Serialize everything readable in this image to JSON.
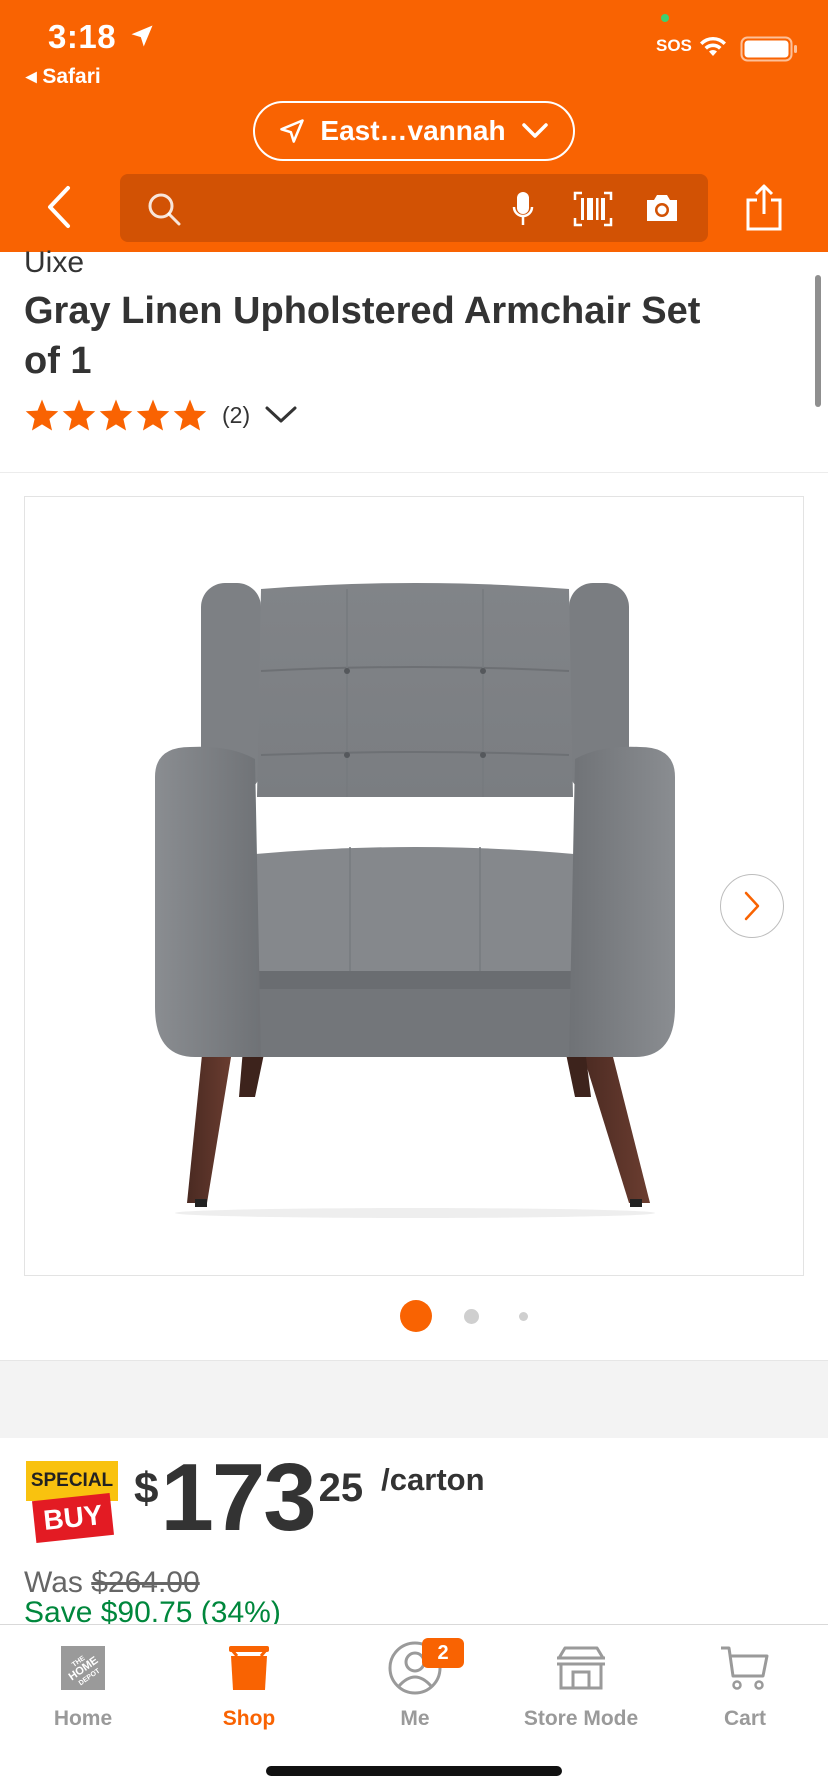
{
  "status_bar": {
    "time": "3:18",
    "back_app": "◂ Safari",
    "sos": "SOS"
  },
  "header": {
    "store_label": "East…vannah",
    "search_placeholder": "",
    "icons": [
      "back-chevron-icon",
      "search-icon",
      "microphone-icon",
      "barcode-scan-icon",
      "camera-icon",
      "share-icon"
    ],
    "brand_color": "#f96302"
  },
  "product": {
    "brand": "Uixe",
    "title": "Gray Linen Upholstered Armchair Set of 1",
    "rating_stars": 5,
    "review_count": "(2)",
    "image_count": 3,
    "active_image_index": 0
  },
  "price": {
    "badge_top": "SPECIAL",
    "badge_bottom": "BUY",
    "currency": "$",
    "dollars": "173",
    "cents": "25",
    "unit": "/carton",
    "was_label": "Was ",
    "was_price": "$264.00",
    "save_text": "Save $90.75 (34%)",
    "save_color": "#00873c"
  },
  "tabbar": {
    "tabs": [
      {
        "label": "Home",
        "icon": "home-depot-logo-icon",
        "active": false
      },
      {
        "label": "Shop",
        "icon": "shop-bag-icon",
        "active": true
      },
      {
        "label": "Me",
        "icon": "person-icon",
        "active": false,
        "badge": "2"
      },
      {
        "label": "Store Mode",
        "icon": "store-icon",
        "active": false
      },
      {
        "label": "Cart",
        "icon": "cart-icon",
        "active": false
      }
    ]
  }
}
